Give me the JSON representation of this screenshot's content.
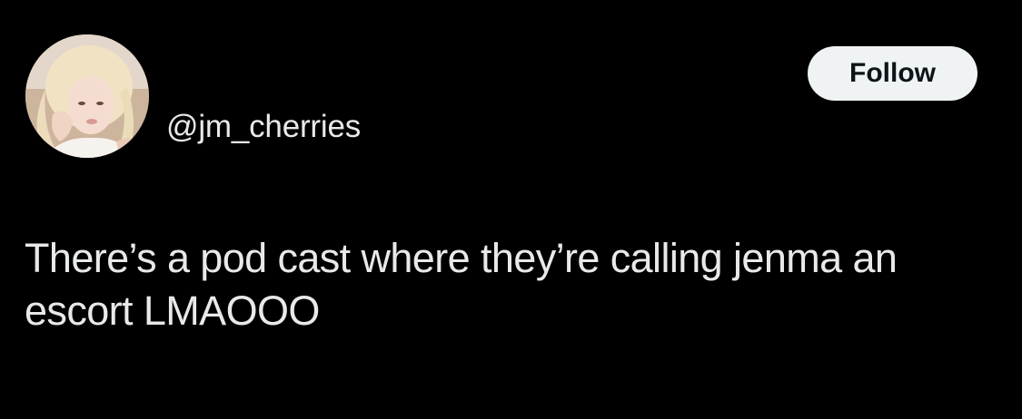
{
  "tweet": {
    "author": {
      "handle": "@jm_cherries",
      "avatar_icon": "profile-photo"
    },
    "follow_label": "Follow",
    "text": "There’s a pod cast where they’re calling jenma an escort LMAOOO"
  },
  "colors": {
    "background": "#000000",
    "text": "#e7e9ea",
    "follow_button_bg": "#eff3f4",
    "follow_button_text": "#0f1419"
  }
}
